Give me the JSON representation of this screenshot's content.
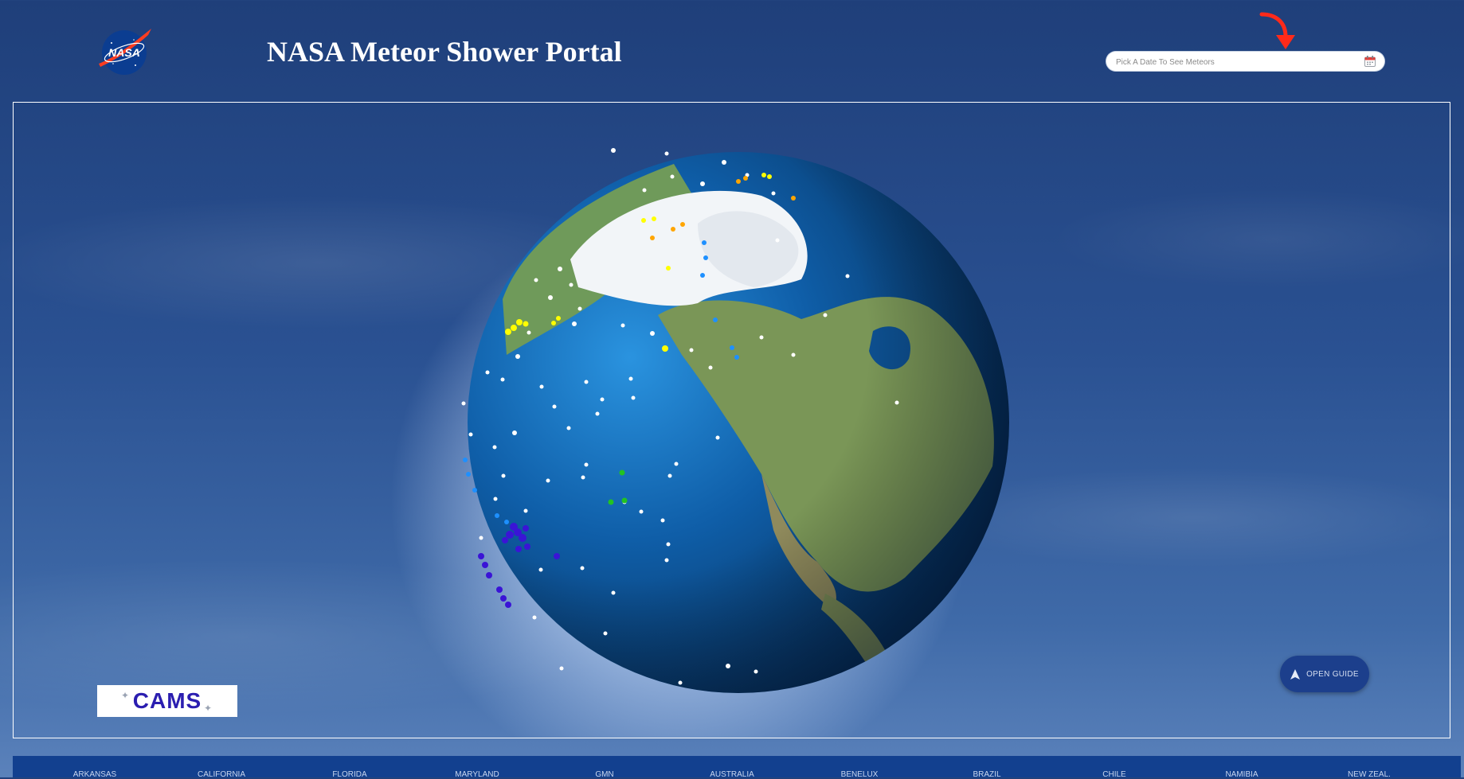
{
  "header": {
    "logo_text": "NASA",
    "title": "NASA Meteor Shower Portal",
    "date_picker": {
      "placeholder": "Pick A Date To See Meteors",
      "value": ""
    }
  },
  "icons": {
    "logo": "nasa-meatball-logo",
    "calendar": "calendar-icon",
    "arrow": "red-curved-arrow-icon",
    "guide": "navigation-arrow-icon"
  },
  "globe": {
    "view": "3d-earth-north-america-pacific",
    "meteor_colors": [
      "#ffffff",
      "#ffff00",
      "#ffa500",
      "#1e90ff",
      "#3a14d6",
      "#22c322"
    ]
  },
  "badges": {
    "cams_text": "CAMS"
  },
  "guide_button": {
    "label": "OPEN GUIDE"
  },
  "footer": {
    "networks": [
      "ARKANSAS",
      "CALIFORNIA",
      "FLORIDA",
      "MARYLAND",
      "GMN",
      "AUSTRALIA",
      "BENELUX",
      "BRAZIL",
      "CHILE",
      "NAMIBIA",
      "NEW ZEAL."
    ]
  },
  "colors": {
    "accent": "#1c3f8c",
    "footer_bg": "#12408f",
    "arrow": "#ff2a1a"
  }
}
